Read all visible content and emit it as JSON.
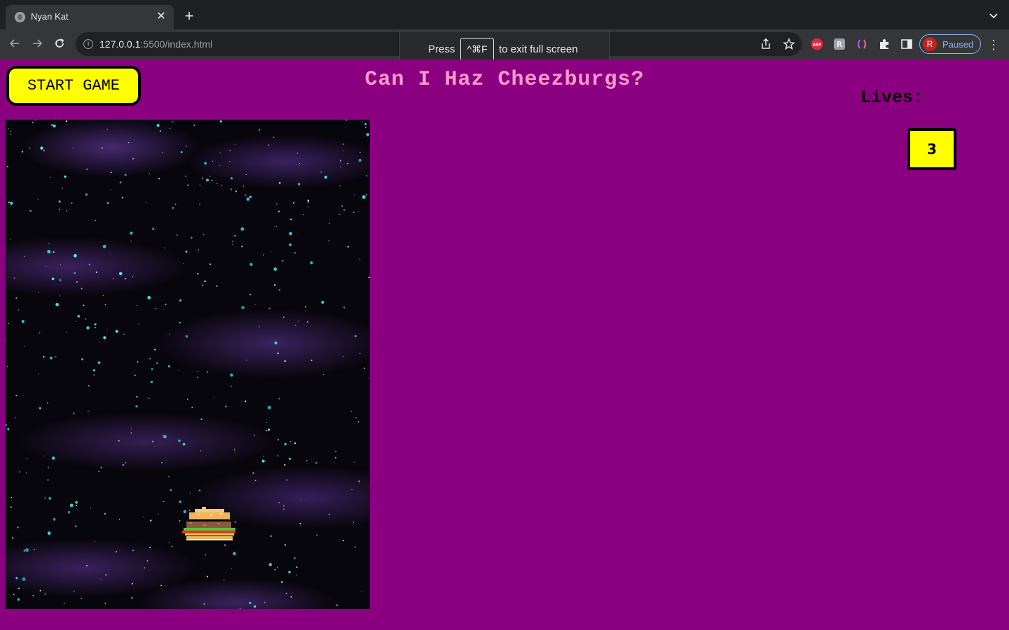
{
  "browser": {
    "tab_title": "Nyan Kat",
    "url_host": "127.0.0.1",
    "url_path": ":5500/index.html",
    "profile_initial": "R",
    "profile_label": "Paused",
    "fullscreen_notice": {
      "press": "Press",
      "key": "^⌘F",
      "rest": "to exit full screen"
    },
    "extensions": [
      "abp-icon",
      "ext-r-icon",
      "ext-brackets-icon",
      "puzzle-icon",
      "sidebar-icon"
    ]
  },
  "game": {
    "start_button_label": "START GAME",
    "title": "Can I Haz Cheezburgs?",
    "lives_label": "Lives:",
    "lives_value": "3"
  },
  "colors": {
    "page_background": "#8b0080",
    "button_yellow": "#ffff00",
    "title_pink": "#ff99cc"
  }
}
